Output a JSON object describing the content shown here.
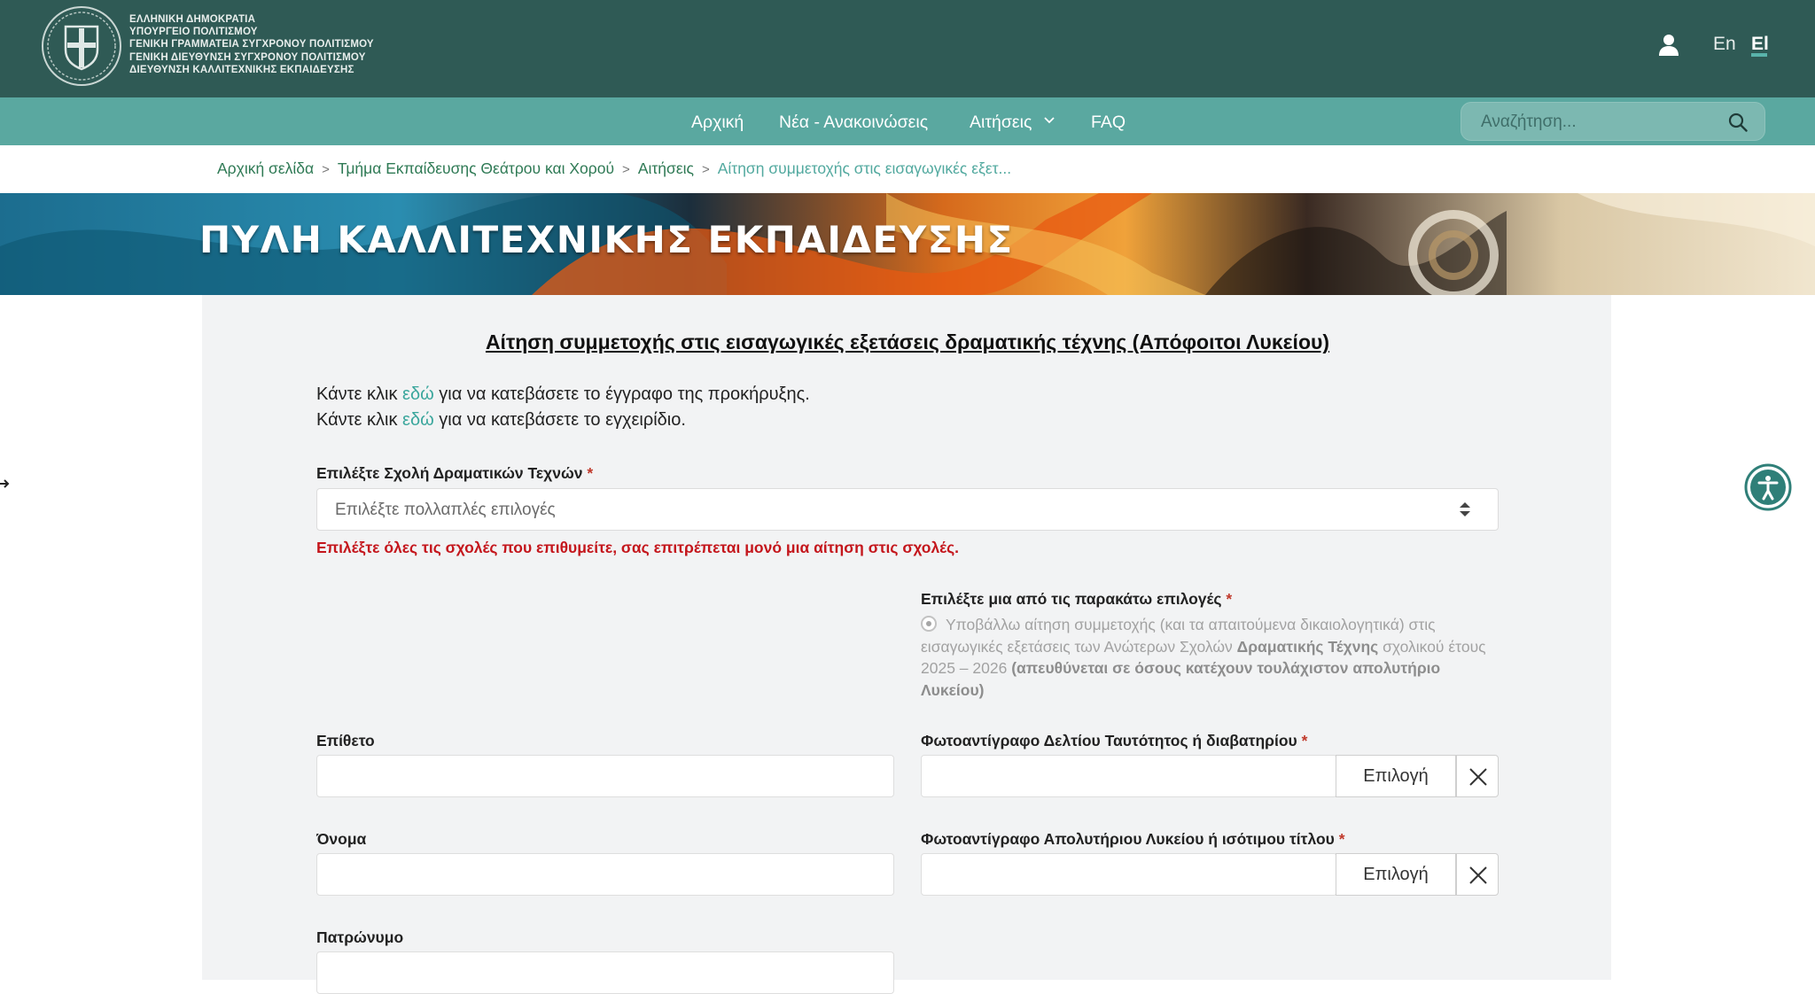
{
  "header": {
    "gov_lines": [
      "ΕΛΛΗΝΙΚΗ ΔΗΜΟΚΡΑΤΙΑ",
      "ΥΠΟΥΡΓΕΙΟ ΠΟΛΙΤΙΣΜΟΥ",
      "ΓΕΝΙΚΗ ΓΡΑΜΜΑΤΕΙΑ ΣΥΓΧΡΟΝΟΥ ΠΟΛΙΤΙΣΜΟΥ",
      "ΓΕΝΙΚΗ ΔΙΕΥΘΥΝΣΗ ΣΥΓΧΡΟΝΟΥ ΠΟΛΙΤΙΣΜΟΥ",
      "ΔΙΕΥΘΥΝΣΗ ΚΑΛΛΙΤΕΧΝΙΚΗΣ ΕΚΠΑΙΔΕΥΣΗΣ"
    ],
    "logo_icon": "greek-coat-of-arms-seal",
    "user_icon": "user-icon",
    "languages": {
      "en": "En",
      "el": "El",
      "active": "el"
    }
  },
  "nav": {
    "items": [
      {
        "label": "Αρχική"
      },
      {
        "label": "Νέα - Ανακοινώσεις"
      },
      {
        "label": "Αιτήσεις",
        "has_dropdown": true
      },
      {
        "label": "FAQ"
      }
    ],
    "search": {
      "placeholder": "Αναζήτηση..."
    }
  },
  "breadcrumb": [
    "Αρχική σελίδα",
    "Τμήμα Εκπαίδευσης Θεάτρου και Χορού",
    "Αιτήσεις",
    "Αίτηση συμμετοχής στις εισαγωγικές εξετ..."
  ],
  "banner": {
    "title": "ΠΥΛΗ ΚΑΛΛΙΤΕΧΝΙΚΗΣ ΕΚΠΑΙΔΕΥΣΗΣ"
  },
  "form": {
    "title": "Αίτηση συμμετοχής στις εισαγωγικές εξετάσεις δραματικής τέχνης (Απόφοιτοι Λυκείου)",
    "info": [
      {
        "pre": "Κάντε κλικ ",
        "link": "εδώ",
        "post": " για να κατεβάσετε το έγγραφο της προκήρυξης."
      },
      {
        "pre": "Κάντε κλικ ",
        "link": "εδώ",
        "post": " για να κατεβάσετε το εγχειρίδιο."
      }
    ],
    "school": {
      "label": "Επιλέξτε Σχολή Δραματικών Τεχνών",
      "placeholder": "Επιλέξτε πολλαπλές επιλογές",
      "warning": "Επιλέξτε όλες τις σχολές που επιθυμείτε, σας επιτρέπεται μονό μια αίτηση στις σχολές."
    },
    "option": {
      "label": "Επιλέξτε μια από τις παρακάτω επιλογές",
      "text_1": "Υποβάλλω αίτηση συμμετοχής (και τα απαιτούμενα δικαιολογητικά) στις εισαγωγικές εξετάσεις των Ανώτερων Σχολών ",
      "text_bold_1": "Δραματικής Τέχνης",
      "text_2": " σχολικού έτους 2025 – 2026 ",
      "text_bold_2": "(απευθύνεται σε όσους κατέχουν τουλάχιστον απολυτήριο Λυκείου)",
      "selected": true
    },
    "surname": {
      "label": "Επίθετο",
      "value": ""
    },
    "name": {
      "label": "Όνομα",
      "value": ""
    },
    "father_name": {
      "label": "Πατρώνυμο",
      "value": ""
    },
    "id_copy": {
      "label": "Φωτοαντίγραφο Δελτίου Ταυτότητος ή διαβατηρίου",
      "button": "Επιλογή"
    },
    "diploma_copy": {
      "label": "Φωτοαντίγραφο Απολυτήριου Λυκείου ή ισότιμου τίτλου ",
      "button": "Επιλογή"
    },
    "required_mark": "*"
  },
  "colors": {
    "header_bg": "#2f5a55",
    "nav_bg": "#5aa8a0",
    "link": "#3aa69c",
    "warning": "#c4161c",
    "accessibility": "#2f7f78"
  }
}
